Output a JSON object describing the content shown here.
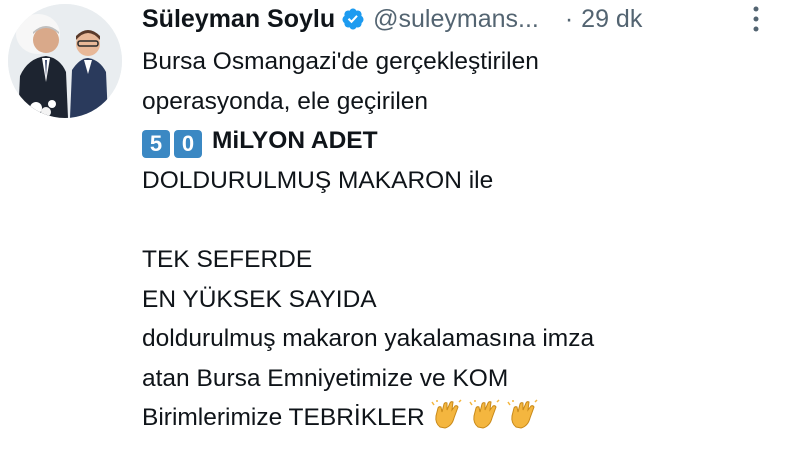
{
  "tweet": {
    "author": {
      "name": "Süleyman Soylu",
      "handle": "@suleymans...",
      "verified": true,
      "avatar_icon": "profile-photo"
    },
    "separator": "·",
    "time": "29 dk",
    "more_icon": "more-vertical-icon",
    "lines": [
      "Bursa Osmangazi'de gerçekleştirilen",
      "operasyonda, ele geçirilen",
      "MiLYON ADET",
      "DOLDURULMUŞ MAKARON ile",
      "",
      "TEK SEFERDE",
      "EN YÜKSEK SAYIDA",
      "doldurulmuş makaron yakalamasına imza",
      "atan Bursa Emniyetimize ve KOM",
      "Birimlerimize TEBRİKLER"
    ],
    "keycaps": [
      "5",
      "0"
    ],
    "emoji": {
      "name": "clapping-hands-icon",
      "count": 3
    },
    "colors": {
      "verified": "#1d9bf0",
      "keycap": "#3b88c3",
      "secondary_text": "#536471",
      "clap": "#f4b63f"
    }
  }
}
